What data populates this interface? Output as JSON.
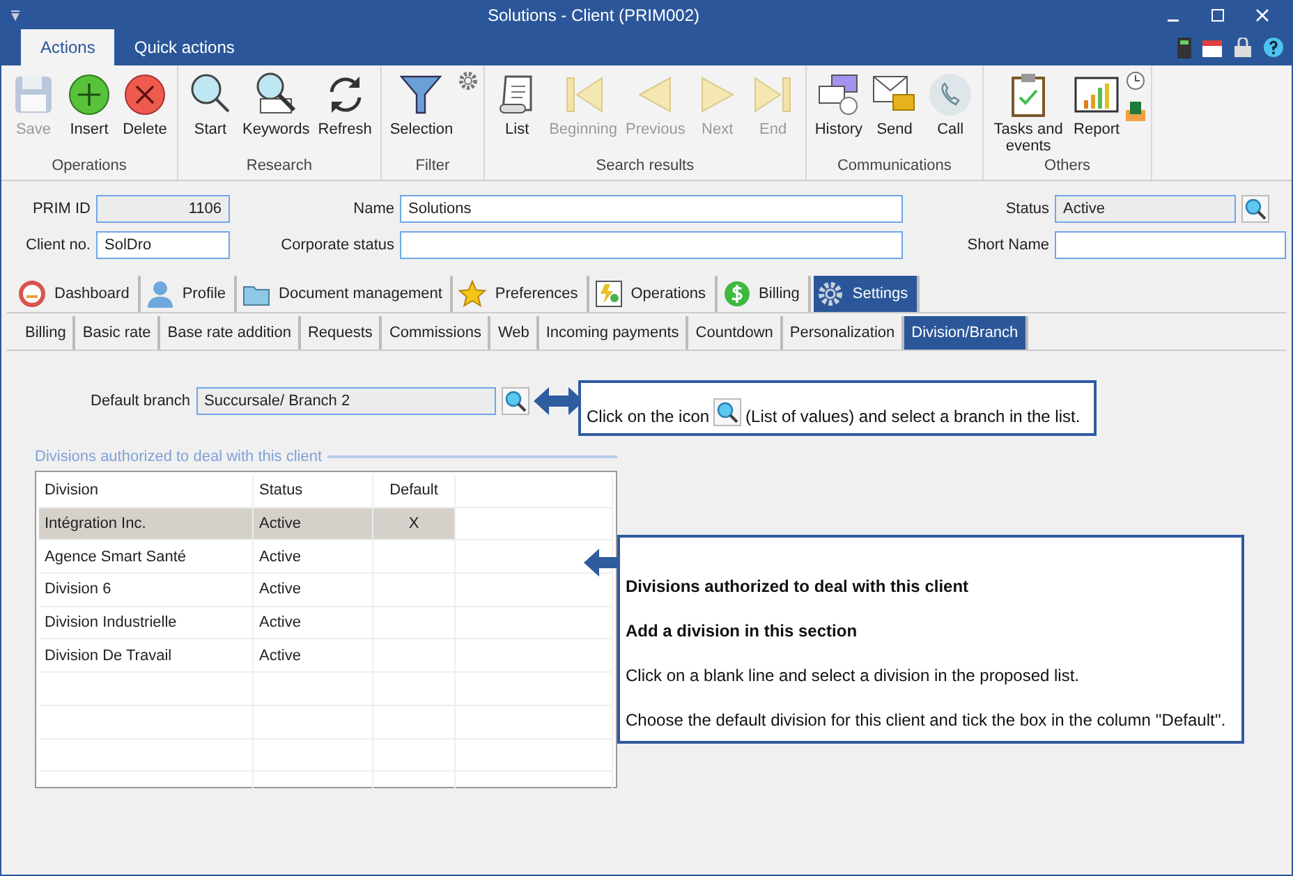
{
  "window": {
    "title": "Solutions - Client (PRIM002)"
  },
  "ribbon_tabs": [
    {
      "label": "Actions",
      "selected": true
    },
    {
      "label": "Quick actions",
      "selected": false
    }
  ],
  "ribbon_groups": [
    {
      "label": "Operations",
      "buttons": [
        {
          "label": "Save",
          "disabled": true
        },
        {
          "label": "Insert",
          "disabled": false
        },
        {
          "label": "Delete",
          "disabled": false
        }
      ]
    },
    {
      "label": "Research",
      "buttons": [
        {
          "label": "Start",
          "disabled": false
        },
        {
          "label": "Keywords",
          "disabled": false
        },
        {
          "label": "Refresh",
          "disabled": false
        }
      ]
    },
    {
      "label": "Filter",
      "buttons": [
        {
          "label": "Selection",
          "disabled": false
        }
      ]
    },
    {
      "label": "Search results",
      "buttons": [
        {
          "label": "List",
          "disabled": false
        },
        {
          "label": "Beginning",
          "disabled": true
        },
        {
          "label": "Previous",
          "disabled": true
        },
        {
          "label": "Next",
          "disabled": true
        },
        {
          "label": "End",
          "disabled": true
        }
      ]
    },
    {
      "label": "Communications",
      "buttons": [
        {
          "label": "History",
          "disabled": false
        },
        {
          "label": "Send",
          "disabled": false
        },
        {
          "label": "Call",
          "disabled": false
        }
      ]
    },
    {
      "label": "Others",
      "buttons": [
        {
          "label": "Tasks and events",
          "disabled": false
        },
        {
          "label": "Report",
          "disabled": false
        }
      ]
    }
  ],
  "form": {
    "prim_id": {
      "label": "PRIM ID",
      "value": "1106"
    },
    "name": {
      "label": "Name",
      "value": "Solutions"
    },
    "status": {
      "label": "Status",
      "value": "Active"
    },
    "client_no": {
      "label": "Client no.",
      "value": "SolDro"
    },
    "corporate_status": {
      "label": "Corporate status"
    },
    "short_name": {
      "label": "Short Name"
    }
  },
  "tabs": [
    {
      "label": "Dashboard",
      "selected": false
    },
    {
      "label": "Profile",
      "selected": false
    },
    {
      "label": "Document management",
      "selected": false
    },
    {
      "label": "Preferences",
      "selected": false
    },
    {
      "label": "Operations",
      "selected": false
    },
    {
      "label": "Billing",
      "selected": false
    },
    {
      "label": "Settings",
      "selected": true
    }
  ],
  "subtabs": [
    {
      "label": "Billing",
      "selected": false
    },
    {
      "label": "Basic rate",
      "selected": false
    },
    {
      "label": "Base rate addition",
      "selected": false
    },
    {
      "label": "Requests",
      "selected": false
    },
    {
      "label": "Commissions",
      "selected": false
    },
    {
      "label": "Web",
      "selected": false
    },
    {
      "label": "Incoming payments",
      "selected": false
    },
    {
      "label": "Countdown",
      "selected": false
    },
    {
      "label": "Personalization",
      "selected": false
    },
    {
      "label": "Division/Branch",
      "selected": true
    }
  ],
  "default_branch": {
    "label": "Default branch",
    "value": "Succursale/ Branch 2"
  },
  "divisions": {
    "legend": "Divisions authorized to deal with this client",
    "columns": [
      "Division",
      "Status",
      "Default"
    ],
    "rows": [
      {
        "cells": [
          "Intégration Inc.",
          "Active",
          "X"
        ],
        "selected": true
      },
      {
        "cells": [
          "Agence Smart Santé",
          "Active",
          ""
        ],
        "selected": false
      },
      {
        "cells": [
          "Division 6",
          "Active",
          ""
        ],
        "selected": false
      },
      {
        "cells": [
          "Division Industrielle",
          "Active",
          ""
        ],
        "selected": false
      },
      {
        "cells": [
          "Division De Travail",
          "Active",
          ""
        ],
        "selected": false
      }
    ]
  },
  "callouts": [
    {
      "before_icon": "Click on the icon",
      "after_icon": "(List of values) and select a branch in the list."
    },
    {
      "lines": [
        {
          "text": "Divisions authorized to deal with this client",
          "bold": true
        },
        {
          "text": "Add a division in this section",
          "bold": true
        },
        {
          "text": "Click on a blank line and select a division in the proposed list.",
          "bold": false
        },
        {
          "text": "Choose the default division for this client and tick the box in the column ''Default''.",
          "bold": false
        }
      ]
    }
  ]
}
